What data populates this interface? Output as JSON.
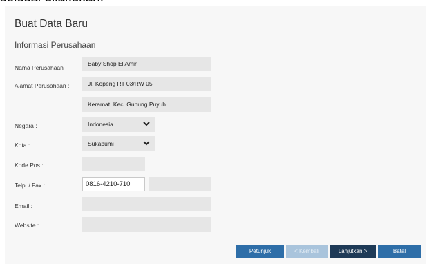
{
  "top_text": "selesai dilakukan.",
  "dialog": {
    "title": "Buat Data Baru",
    "section_title": "Informasi Perusahaan"
  },
  "form": {
    "company_name": {
      "label": "Nama Perusahaan :",
      "value": "Baby Shop El Amir"
    },
    "company_address": {
      "label": "Alamat Perusahaan :",
      "line1": "Jl. Kopeng RT 03/RW 05",
      "line2": "Keramat, Kec. Gunung Puyuh"
    },
    "country": {
      "label": "Negara :",
      "value": "Indonesia"
    },
    "city": {
      "label": "Kota :",
      "value": "Sukabumi"
    },
    "postal_code": {
      "label": "Kode Pos :",
      "value": ""
    },
    "phone_fax": {
      "label": "Telp. / Fax :",
      "phone": "0816-4210-710",
      "fax": ""
    },
    "email": {
      "label": "Email :",
      "value": ""
    },
    "website": {
      "label": "Website :",
      "value": ""
    }
  },
  "buttons": {
    "help": {
      "key": "P",
      "rest": "etunjuk"
    },
    "back": {
      "prefix": "< ",
      "key": "K",
      "rest": "embali"
    },
    "next": {
      "key": "L",
      "rest": "anjutkan >"
    },
    "cancel": {
      "key": "B",
      "rest": "atal"
    }
  },
  "colors": {
    "panel_bg": "#f7f7f7",
    "field_bg": "#e6e6e6",
    "button_blue": "#2e6ea8",
    "button_dark": "#1e3a57",
    "button_disabled": "#a9c4dc"
  },
  "icons": {
    "dropdown": "chevron-down-icon"
  }
}
